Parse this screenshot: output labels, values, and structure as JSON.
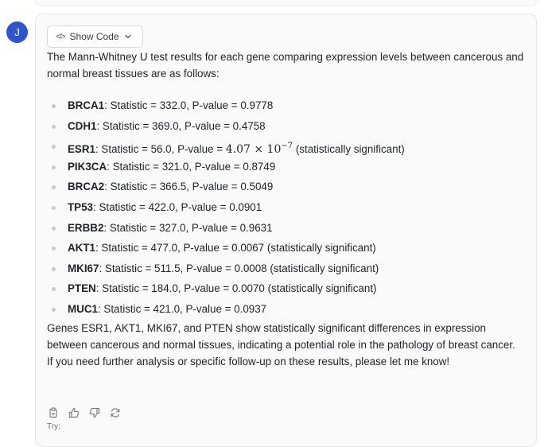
{
  "avatar": {
    "letter": "J",
    "color": "#2f55c9"
  },
  "show_code": {
    "label": "Show Code",
    "code_glyph": "</>"
  },
  "message": {
    "intro": "The Mann-Whitney U test results for each gene comparing expression levels between cancerous and normal breast tissues are as follows:",
    "genes": [
      {
        "name": "BRCA1",
        "rest": ": Statistic = 332.0, P-value = 0.9778"
      },
      {
        "name": "CDH1",
        "rest": ": Statistic = 369.0, P-value = 0.4758"
      },
      {
        "name": "ESR1",
        "rest": ": Statistic = 56.0, P-value = ",
        "math_base": "4.07 × 10",
        "math_exp": "−7",
        "after": " (statistically significant)"
      },
      {
        "name": "PIK3CA",
        "rest": ": Statistic = 321.0, P-value = 0.8749"
      },
      {
        "name": "BRCA2",
        "rest": ": Statistic = 366.5, P-value = 0.5049"
      },
      {
        "name": "TP53",
        "rest": ": Statistic = 422.0, P-value = 0.0901"
      },
      {
        "name": "ERBB2",
        "rest": ": Statistic = 327.0, P-value = 0.9631"
      },
      {
        "name": "AKT1",
        "rest": ": Statistic = 477.0, P-value = 0.0067 (statistically significant)"
      },
      {
        "name": "MKI67",
        "rest": ": Statistic = 511.5, P-value = 0.0008 (statistically significant)"
      },
      {
        "name": "PTEN",
        "rest": ": Statistic = 184.0, P-value = 0.0070 (statistically significant)"
      },
      {
        "name": "MUC1",
        "rest": ": Statistic = 421.0, P-value = 0.0937"
      }
    ],
    "summary": "Genes ESR1, AKT1, MKI67, and PTEN show statistically significant differences in expression between cancerous and normal tissues, indicating a potential role in the pathology of breast cancer.",
    "followup": "If you need further analysis or specific follow-up on these results, please let me know!"
  },
  "actions": {
    "icons": [
      "copy-icon",
      "thumbs-up-icon",
      "thumbs-down-icon",
      "regenerate-icon"
    ]
  },
  "try_label": "Try:"
}
